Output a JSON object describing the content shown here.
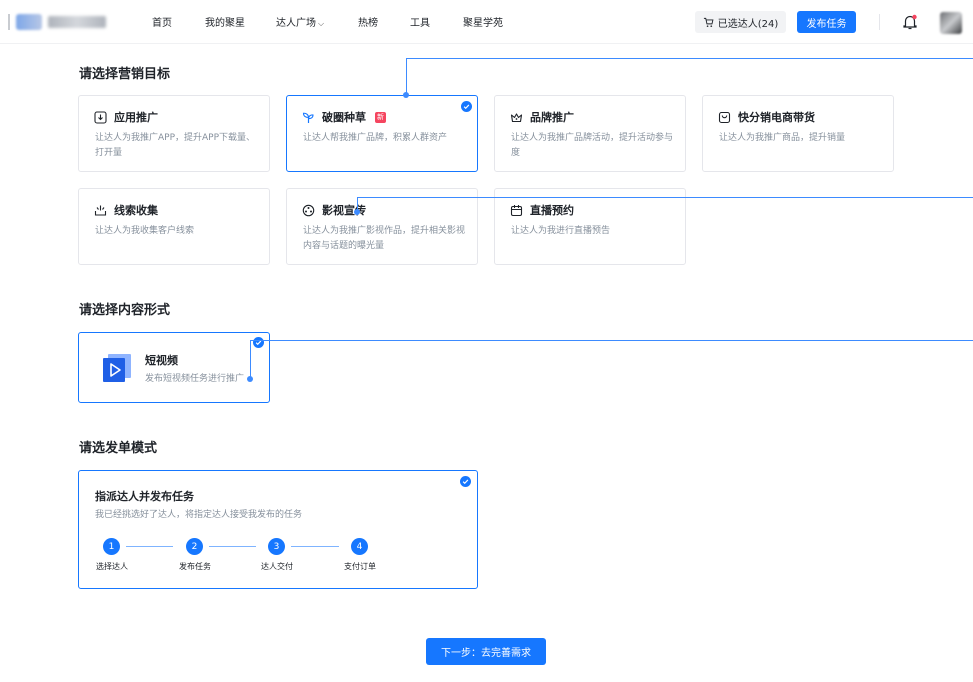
{
  "nav": {
    "items": [
      "首页",
      "我的聚星",
      "达人广场",
      "热榜",
      "工具",
      "聚星学苑"
    ],
    "selected_creators": "已选达人(24)",
    "publish": "发布任务"
  },
  "goal_section": {
    "title": "请选择营销目标",
    "cards": [
      {
        "title": "应用推广",
        "desc": "让达人为我推广APP，提升APP下载量、打开量",
        "icon": "download-box-icon"
      },
      {
        "title": "破圈种草",
        "badge": "新",
        "desc": "让达人帮我推广品牌，积累人群资产",
        "icon": "sprout-icon",
        "selected": true
      },
      {
        "title": "品牌推广",
        "desc": "让达人为我推广品牌活动，提升活动参与度",
        "icon": "crown-icon"
      },
      {
        "title": "快分销电商带货",
        "desc": "让达人为我推广商品，提升销量",
        "icon": "shopping-bag-icon"
      },
      {
        "title": "线索收集",
        "desc": "让达人为我收集客户线索",
        "icon": "collect-icon"
      },
      {
        "title": "影视宣传",
        "desc": "让达人为我推广影视作品，提升相关影视内容与话题的曝光量",
        "icon": "film-reel-icon"
      },
      {
        "title": "直播预约",
        "desc": "让达人为我进行直播预告",
        "icon": "calendar-icon"
      }
    ]
  },
  "content_section": {
    "title": "请选择内容形式",
    "card": {
      "title": "短视频",
      "desc": "发布短视频任务进行推广"
    }
  },
  "mode_section": {
    "title": "请选发单模式",
    "card": {
      "title": "指派达人并发布任务",
      "desc": "我已经挑选好了达人，将指定达人接受我发布的任务",
      "steps": [
        {
          "num": "1",
          "label": "选择达人"
        },
        {
          "num": "2",
          "label": "发布任务"
        },
        {
          "num": "3",
          "label": "达人交付"
        },
        {
          "num": "4",
          "label": "支付订单"
        }
      ]
    }
  },
  "next_button": "下一步：去完善需求",
  "colors": {
    "accent": "#1677ff",
    "badge": "#f5455f",
    "muted": "#86909c"
  }
}
